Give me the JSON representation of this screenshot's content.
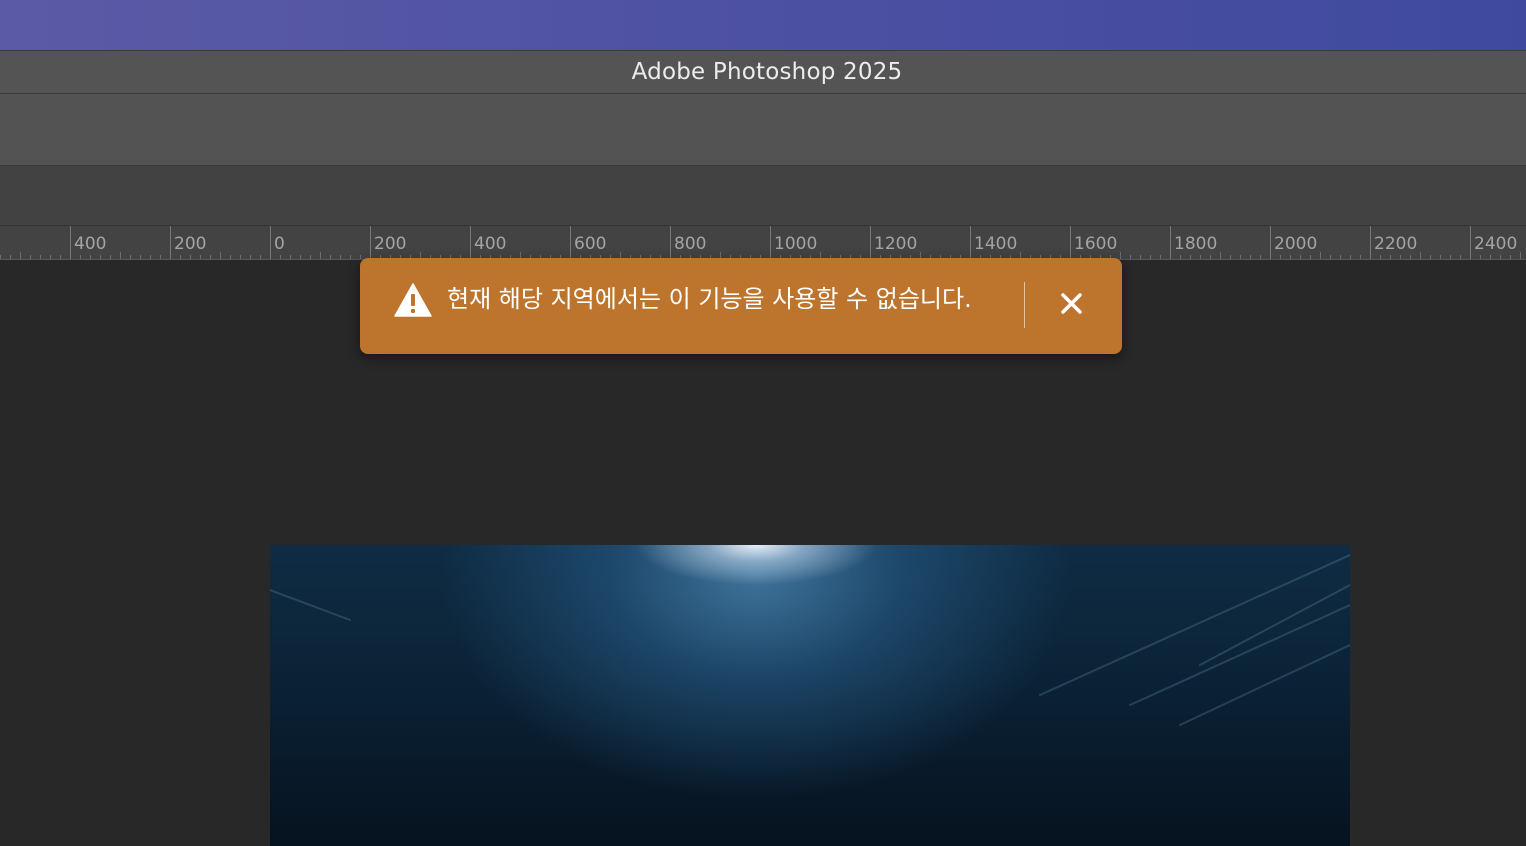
{
  "window": {
    "title": "Adobe Photoshop 2025"
  },
  "ruler": {
    "labels": [
      "0",
      "400",
      "200",
      "0",
      "200",
      "400",
      "600",
      "800",
      "1000",
      "1200",
      "1400",
      "1600",
      "1800",
      "2000",
      "2200",
      "2400"
    ]
  },
  "toast": {
    "message": "현재 해당 지역에서는 이 기능을 사용할 수 없습니다.",
    "icon": "warning-icon",
    "close_icon": "close-icon",
    "color": "#bd752e"
  }
}
